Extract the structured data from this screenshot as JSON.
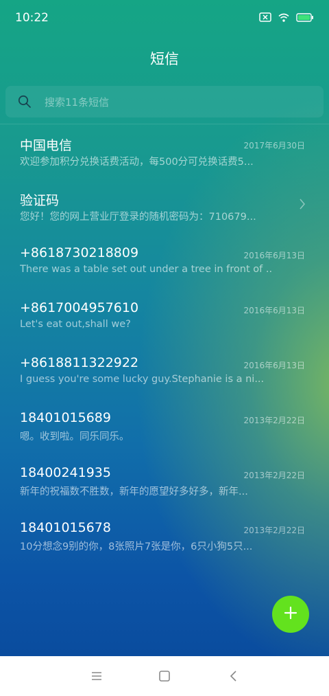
{
  "status_bar": {
    "time": "10:22",
    "icons": [
      "no-sim-icon",
      "wifi-icon",
      "battery-icon"
    ]
  },
  "header": {
    "title": "短信"
  },
  "search": {
    "placeholder": "搜索11条短信"
  },
  "messages": [
    {
      "name": "中国电信",
      "date": "2017年6月30日",
      "preview": "欢迎参加积分兑换话费活动，每500分可兑换话费5..."
    },
    {
      "name": "验证码",
      "date": "",
      "preview": "您好！您的网上营业厅登录的随机密码为：710679...",
      "icon": "chevron-right-icon"
    },
    {
      "name": "+8618730218809",
      "date": "2016年6月13日",
      "preview": "There was a table set out under a tree in front of ..."
    },
    {
      "name": "+8617004957610",
      "date": "2016年6月13日",
      "preview": "Let's eat out,shall we?"
    },
    {
      "name": "+8618811322922",
      "date": "2016年6月13日",
      "preview": "I guess you're some lucky guy.Stephanie is a ni..."
    },
    {
      "name": "18401015689",
      "date": "2013年2月22日",
      "preview": "嗯。收到啦。同乐同乐。"
    },
    {
      "name": "18400241935",
      "date": "2013年2月22日",
      "preview": "新年的祝福数不胜数，新年的愿望好多好多，新年..."
    },
    {
      "name": "18401015678",
      "date": "2013年2月22日",
      "preview": "10分想念9别的你，8张照片7张是你，6只小狗5只..."
    }
  ],
  "fab": {
    "icon": "plus-icon",
    "color": "#63e21e"
  },
  "nav_bar": {
    "icons": [
      "menu-icon",
      "home-icon",
      "back-icon"
    ]
  },
  "colors": {
    "battery": "#3ee27a",
    "accent": "#63e21e"
  }
}
